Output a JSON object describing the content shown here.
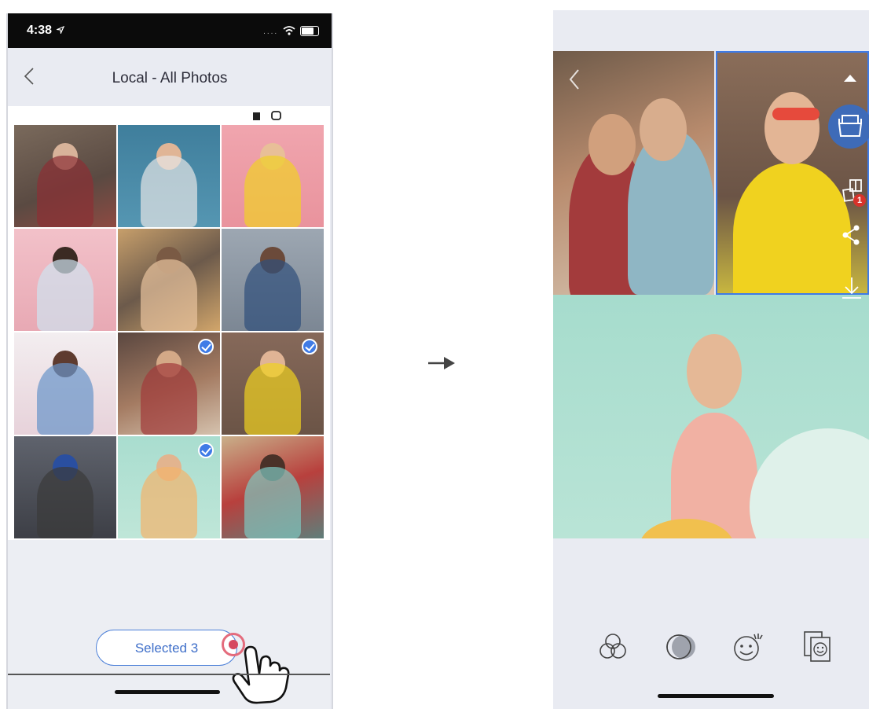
{
  "left_screen": {
    "status": {
      "time": "4:38",
      "signal": "....",
      "location_icon": "location-arrow-icon",
      "wifi_icon": "wifi-icon",
      "battery_icon": "battery-icon"
    },
    "header": {
      "back_icon": "chevron-left-icon",
      "title": "Local - All Photos"
    },
    "peek_icons": [
      "facebook-icon",
      "instagram-icon"
    ],
    "photos": [
      {
        "id": "girls-friends",
        "selected": false
      },
      {
        "id": "girl-confetti",
        "selected": false
      },
      {
        "id": "girl-donut",
        "selected": false
      },
      {
        "id": "girl-pink-wall",
        "selected": false
      },
      {
        "id": "group-lying",
        "selected": false
      },
      {
        "id": "couple-denim",
        "selected": false
      },
      {
        "id": "girls-flower-wall",
        "selected": false
      },
      {
        "id": "couple-selfie",
        "selected": true
      },
      {
        "id": "girl-heart-glasses",
        "selected": true
      },
      {
        "id": "girl-blue-hair",
        "selected": false
      },
      {
        "id": "girl-balloons",
        "selected": true
      },
      {
        "id": "couple-art",
        "selected": false
      }
    ],
    "selected_button": "Selected 3",
    "hand_icon": "tap-hand-icon"
  },
  "transition_arrow": "right-arrow-icon",
  "right_screen": {
    "collage_icons": [
      "up-arrow-icon",
      "print-icon",
      "collage-layout-icon",
      "share-icon",
      "download-icon"
    ],
    "badge": "1",
    "toolbar": [
      "filters-icon",
      "adjust-icon",
      "stickers-icon",
      "frames-icon"
    ]
  }
}
